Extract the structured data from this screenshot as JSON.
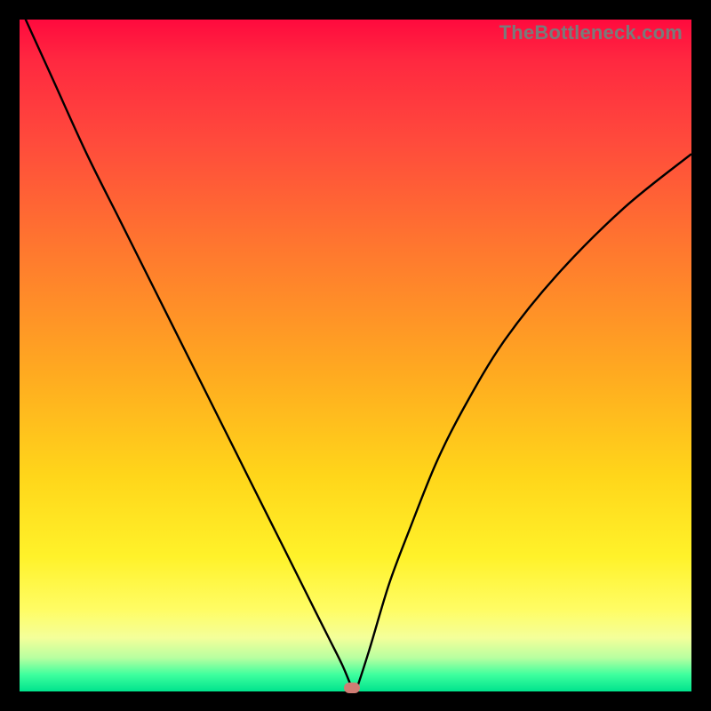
{
  "watermark": "TheBottleneck.com",
  "colors": {
    "frame": "#000000",
    "gradient_top": "#ff0a3e",
    "gradient_bottom": "#00e38d",
    "curve": "#000000",
    "marker": "#cf7d74",
    "watermark_text": "#7a7a7a"
  },
  "chart_data": {
    "type": "line",
    "title": "",
    "xlabel": "",
    "ylabel": "",
    "xlim": [
      0,
      100
    ],
    "ylim": [
      0,
      100
    ],
    "grid": false,
    "legend": false,
    "series": [
      {
        "name": "bottleneck_curve",
        "x": [
          0,
          5,
          10,
          15,
          20,
          25,
          30,
          34,
          38,
          42,
          44,
          46,
          48,
          49.5,
          50,
          52,
          55,
          58,
          62,
          66,
          72,
          80,
          90,
          100
        ],
        "values": [
          102,
          91,
          80,
          70,
          60,
          50,
          40,
          32,
          24,
          16,
          12,
          8,
          4,
          0.5,
          0,
          6,
          16,
          24,
          34,
          42,
          52,
          62,
          72,
          80
        ]
      }
    ],
    "annotations": [
      {
        "name": "min_marker",
        "x": 49.5,
        "y": 0.5
      }
    ]
  }
}
